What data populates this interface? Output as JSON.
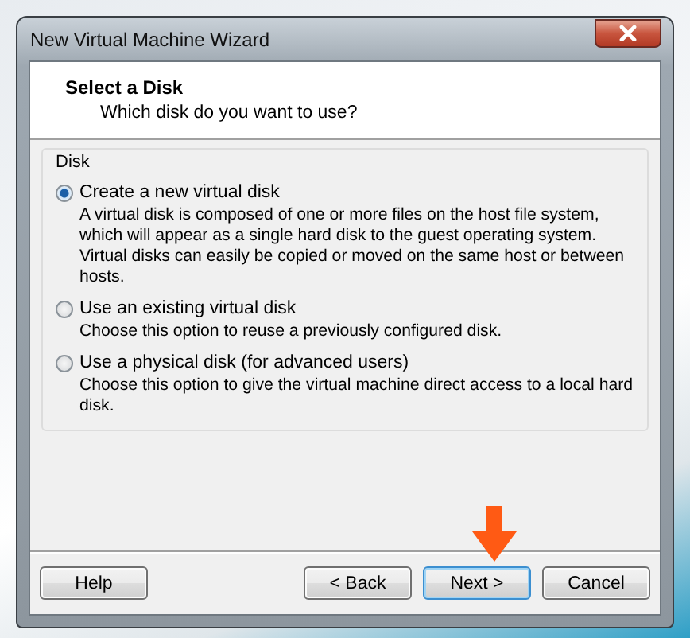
{
  "window": {
    "title": "New Virtual Machine Wizard"
  },
  "header": {
    "title": "Select a Disk",
    "subtitle": "Which disk do you want to use?"
  },
  "disk_group": {
    "label": "Disk",
    "options": [
      {
        "label": "Create a new virtual disk",
        "description": "A virtual disk is composed of one or more files on the host file system, which will appear as a single hard disk to the guest operating system. Virtual disks can easily be copied or moved on the same host or between hosts.",
        "selected": true
      },
      {
        "label": "Use an existing virtual disk",
        "description": "Choose this option to reuse a previously configured disk.",
        "selected": false
      },
      {
        "label": "Use a physical disk (for advanced users)",
        "description": "Choose this option to give the virtual machine direct access to a local hard disk.",
        "selected": false
      }
    ]
  },
  "buttons": [
    {
      "label": "Help",
      "kind": "help",
      "focused": false
    },
    {
      "label": "< Back",
      "kind": "back",
      "focused": false
    },
    {
      "label": "Next >",
      "kind": "next",
      "focused": true
    },
    {
      "label": "Cancel",
      "kind": "cancel",
      "focused": false
    }
  ]
}
